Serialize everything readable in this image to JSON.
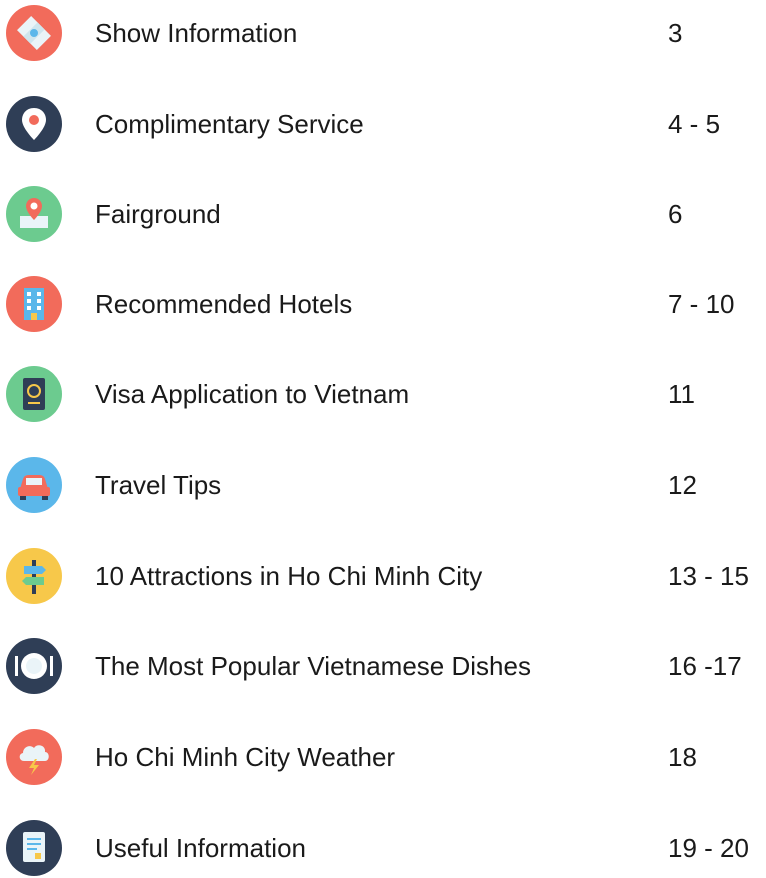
{
  "toc": {
    "entries": [
      {
        "icon": "map-icon",
        "label": "Show Information",
        "pages": "3",
        "color": "#f26b5b"
      },
      {
        "icon": "location-pin-icon",
        "label": "Complimentary Service",
        "pages": "4 - 5",
        "color": "#2f3e56"
      },
      {
        "icon": "fairground-map-icon",
        "label": "Fairground",
        "pages": "6",
        "color": "#6ccb8f"
      },
      {
        "icon": "hotel-building-icon",
        "label": "Recommended Hotels",
        "pages": "7 - 10",
        "color": "#f26b5b"
      },
      {
        "icon": "passport-icon",
        "label": "Visa Application to Vietnam",
        "pages": "11",
        "color": "#6ccb8f"
      },
      {
        "icon": "car-icon",
        "label": "Travel Tips",
        "pages": "12",
        "color": "#5bb7ea"
      },
      {
        "icon": "signpost-icon",
        "label": "10 Attractions in Ho Chi Minh City",
        "pages": "13 - 15",
        "color": "#f7c84a"
      },
      {
        "icon": "dinner-plate-icon",
        "label": "The Most Popular Vietnamese Dishes",
        "pages": "16 -17",
        "color": "#2f3e56"
      },
      {
        "icon": "storm-cloud-icon",
        "label": "Ho Chi Minh City Weather",
        "pages": "18",
        "color": "#f26b5b"
      },
      {
        "icon": "document-icon",
        "label": "Useful Information",
        "pages": "19 - 20",
        "color": "#2f3e56"
      }
    ]
  }
}
